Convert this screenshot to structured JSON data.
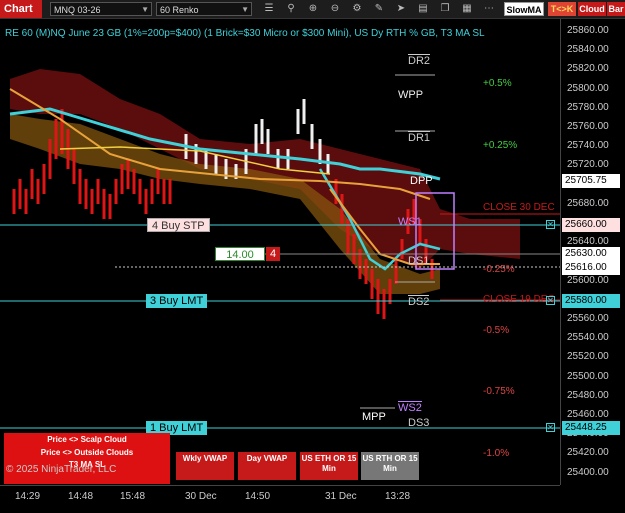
{
  "toolbar": {
    "chart_tab": "Chart",
    "instrument": "MNQ 03-26",
    "interval": "60 Renko",
    "indicator_select": "SlowMA",
    "tck_button": "T<>K",
    "cloud_button": "Cloud",
    "bar_button": "Bar",
    "icons": [
      "list-icon",
      "search-icon",
      "line-tool-icon",
      "zoom-in-icon",
      "zoom-out-icon",
      "properties-icon",
      "drawing-icon",
      "cursor-icon",
      "data-box-icon",
      "windows-icon",
      "grid-icon",
      "more-icon"
    ]
  },
  "chart": {
    "title": "RE 60 (M)NQ June 23 GB (1%=200p=$400) (1 Brick=$30 Micro or $300 Mini), US Dy RTH % GB, T3 MA SL",
    "price_ticks": [
      "25860.00",
      "25840.00",
      "25820.00",
      "25800.00",
      "25780.00",
      "25760.00",
      "25740.00",
      "25720.00",
      "25700.00",
      "25680.00",
      "25660.00",
      "25640.00",
      "25620.00",
      "25600.00",
      "25580.00",
      "25560.00",
      "25540.00",
      "25520.00",
      "25500.00",
      "25480.00",
      "25460.00",
      "25440.00",
      "25420.00",
      "25400.00"
    ],
    "time_ticks": [
      "14:29",
      "14:48",
      "15:48",
      "30 Dec",
      "14:50",
      "31 Dec",
      "13:28"
    ],
    "current_price": "25705.75",
    "price_boxes": {
      "buy_stp": "25660.00",
      "entry": "25630.00",
      "last": "25616.00",
      "buy_lmt_3": "25580.00",
      "buy_lmt_1": "25448.25"
    },
    "orders": {
      "buy_stp": "4 Buy STP",
      "buy_lmt_3": "3 Buy LMT",
      "buy_lmt_1": "1 Buy LMT"
    },
    "position": {
      "price": "14.00",
      "qty": "4"
    },
    "pct_levels": [
      "+0.5%",
      "+0.25%",
      "-0.25%",
      "-0.5%",
      "-0.75%",
      "-1.0%"
    ],
    "close_labels": [
      "CLOSE 30 DEC",
      "CLOSE 19 DEC"
    ],
    "pivots": {
      "dr2": "DR2",
      "wpp": "WPP",
      "dr1": "DR1",
      "dpp": "DPP",
      "ws1": "WS1",
      "ds1": "DS1",
      "ds2": "DS2",
      "ws2": "WS2",
      "mpp": "MPP",
      "ds3": "DS3"
    },
    "copyright": "© 2025 NinjaTrader, LLC"
  },
  "legend": {
    "scalp": "Price <> Scalp Cloud",
    "outside": "Price <> Outside Clouds",
    "t3": "T3 MA SL"
  },
  "bottom_buttons": {
    "wkly_vwap": "Wkly VWAP",
    "day_vwap": "Day VWAP",
    "us_eth": "US ETH OR 15 Min",
    "us_rth": "US RTH OR 15 Min"
  },
  "colors": {
    "accent_red": "#c61a1a",
    "cyan": "#3fd0d8",
    "orange": "#e8a23a",
    "pivot_red": "#ff5a5a",
    "pivot_purple": "#c080ff"
  }
}
